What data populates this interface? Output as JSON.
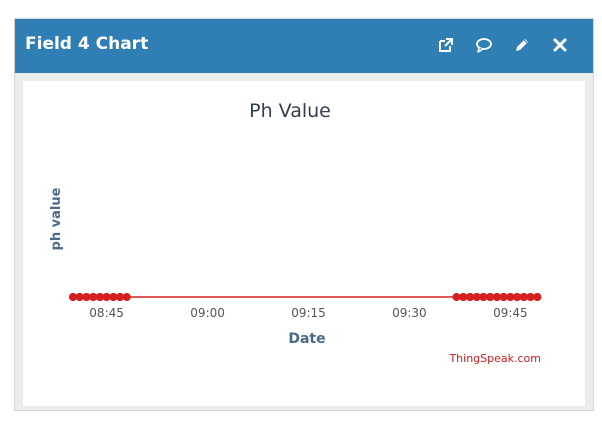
{
  "widget": {
    "title": "Field 4 Chart",
    "tools": [
      {
        "name": "open-external-icon",
        "icon": "external-link"
      },
      {
        "name": "comment-icon",
        "icon": "speech-bubble"
      },
      {
        "name": "edit-icon",
        "icon": "pencil"
      },
      {
        "name": "close-icon",
        "icon": "x"
      }
    ]
  },
  "colors": {
    "header": "#2f7fb5",
    "series": "#d62020",
    "axis_label": "#4a6a8a",
    "title_text": "#333f50",
    "credit": "#cc1c1c"
  },
  "chart_data": {
    "type": "line",
    "title": "Ph Value",
    "xlabel": "Date",
    "ylabel": "ph value",
    "x_ticks": [
      "08:45",
      "09:00",
      "09:15",
      "09:30",
      "09:45"
    ],
    "xlim": [
      "08:40",
      "09:50"
    ],
    "grid": false,
    "credit": "ThingSpeak.com",
    "series": [
      {
        "color": "#d62020",
        "points": [
          [
            "08:40",
            0
          ],
          [
            "08:40",
            0
          ],
          [
            "08:41",
            0
          ],
          [
            "08:41",
            0
          ],
          [
            "08:42",
            0
          ],
          [
            "08:42",
            0
          ],
          [
            "08:43",
            0
          ],
          [
            "08:43",
            0
          ],
          [
            "08:44",
            0
          ],
          [
            "08:44",
            0
          ],
          [
            "08:45",
            0
          ],
          [
            "08:45",
            0
          ],
          [
            "08:46",
            0
          ],
          [
            "08:46",
            0
          ],
          [
            "08:47",
            0
          ],
          [
            "08:47",
            0
          ],
          [
            "08:48",
            0
          ],
          [
            "09:37",
            0
          ],
          [
            "09:38",
            0
          ],
          [
            "09:38",
            0
          ],
          [
            "09:39",
            0
          ],
          [
            "09:39",
            0
          ],
          [
            "09:40",
            0
          ],
          [
            "09:40",
            0
          ],
          [
            "09:41",
            0
          ],
          [
            "09:41",
            0
          ],
          [
            "09:42",
            0
          ],
          [
            "09:42",
            0
          ],
          [
            "09:43",
            0
          ],
          [
            "09:43",
            0
          ],
          [
            "09:44",
            0
          ],
          [
            "09:44",
            0
          ],
          [
            "09:45",
            0
          ],
          [
            "09:45",
            0
          ],
          [
            "09:46",
            0
          ],
          [
            "09:46",
            0
          ],
          [
            "09:47",
            0
          ],
          [
            "09:47",
            0
          ],
          [
            "09:48",
            0
          ],
          [
            "09:48",
            0
          ],
          [
            "09:49",
            0
          ],
          [
            "09:49",
            0
          ]
        ]
      }
    ]
  }
}
